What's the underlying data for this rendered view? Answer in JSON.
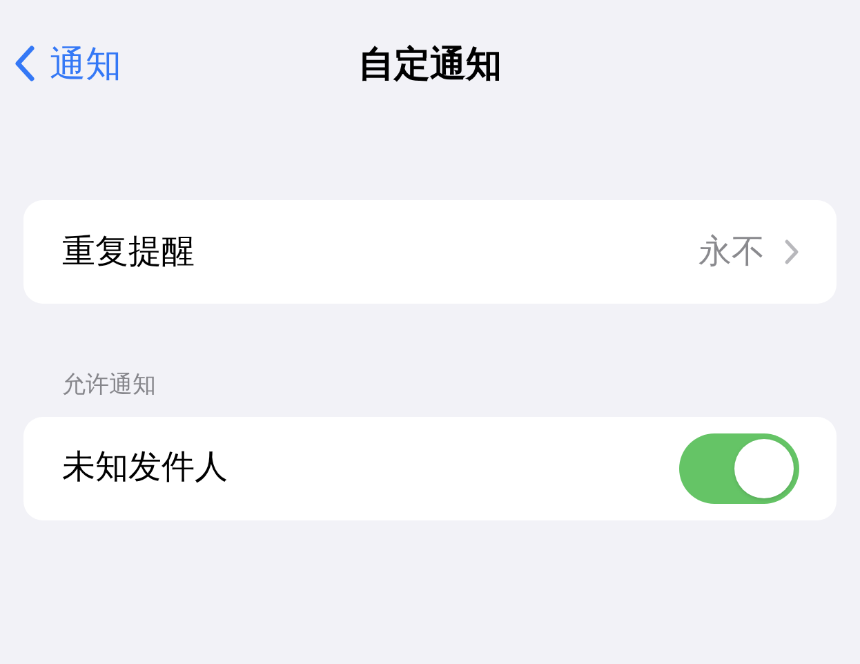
{
  "nav": {
    "back_label": "通知",
    "title": "自定通知"
  },
  "sections": [
    {
      "rows": [
        {
          "kind": "link",
          "label": "重复提醒",
          "value": "永不"
        }
      ]
    },
    {
      "header": "允许通知",
      "rows": [
        {
          "kind": "toggle",
          "label": "未知发件人",
          "on": true
        }
      ]
    }
  ]
}
